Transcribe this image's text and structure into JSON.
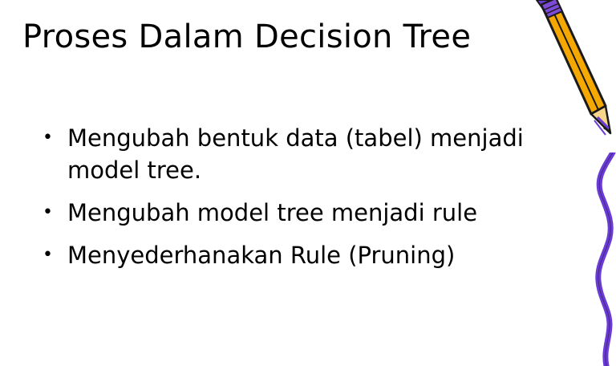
{
  "slide": {
    "title": "Proses Dalam Decision Tree",
    "bullets": [
      {
        "text": "Mengubah bentuk data (tabel) menjadi model tree."
      },
      {
        "text": "Mengubah model tree menjadi rule"
      },
      {
        "text": "Menyederhanakan Rule (Pruning)"
      }
    ],
    "bullet_marker": "•"
  },
  "decorations": {
    "pencil_icon": "pencil-icon",
    "squiggle_icon": "squiggle-line-icon",
    "colors": {
      "pencil_body": "#f5a800",
      "pencil_outline": "#1a1a1a",
      "purple": "#6a3bd6"
    }
  }
}
